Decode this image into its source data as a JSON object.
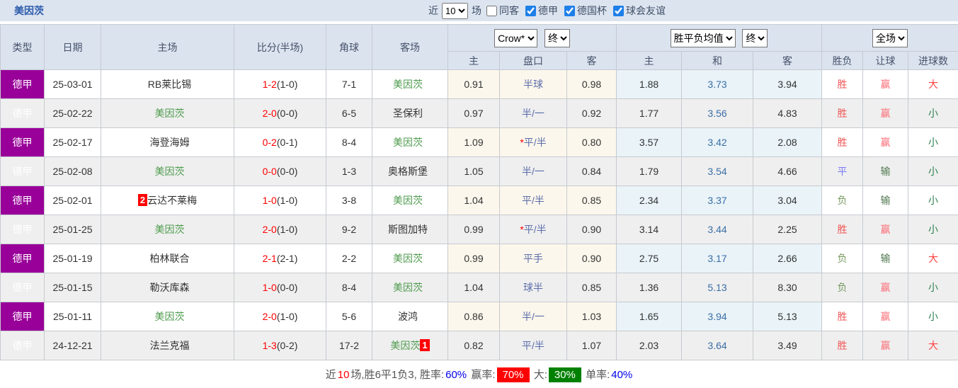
{
  "title": "美因茨",
  "topbar": {
    "near_label": "近",
    "recent_count": "10",
    "field_label": "场",
    "checkboxes": [
      {
        "label": "同客",
        "checked": false
      },
      {
        "label": "德甲",
        "checked": true
      },
      {
        "label": "德国杯",
        "checked": true
      },
      {
        "label": "球会友谊",
        "checked": true
      }
    ]
  },
  "header": {
    "cols": [
      "类型",
      "日期",
      "主场",
      "比分(半场)",
      "角球",
      "客场"
    ],
    "group1_select": "Crow*",
    "group1_final": "终",
    "group2_select": "胜平负均值",
    "group2_final": "终",
    "group3_select": "全场",
    "sub": [
      "主",
      "盘口",
      "客",
      "主",
      "和",
      "客",
      "胜负",
      "让球",
      "进球数"
    ]
  },
  "rows": [
    {
      "league": "德甲",
      "date": "25-03-01",
      "home": "RB莱比锡",
      "home_self": false,
      "home_badge": "",
      "score": "1-2",
      "half": "(1-0)",
      "corners": "7-1",
      "away": "美因茨",
      "away_self": true,
      "away_badge": "",
      "crow_home": "0.91",
      "handicap": "半球",
      "handicap_star": false,
      "crow_away": "0.98",
      "avg_home": "1.88",
      "avg_draw": "3.73",
      "avg_away": "3.94",
      "result": "胜",
      "cover": "赢",
      "goals": "大"
    },
    {
      "league": "德甲",
      "date": "25-02-22",
      "home": "美因茨",
      "home_self": true,
      "home_badge": "",
      "score": "2-0",
      "half": "(0-0)",
      "corners": "6-5",
      "away": "圣保利",
      "away_self": false,
      "away_badge": "",
      "crow_home": "0.97",
      "handicap": "半/一",
      "handicap_star": false,
      "crow_away": "0.92",
      "avg_home": "1.77",
      "avg_draw": "3.56",
      "avg_away": "4.83",
      "result": "胜",
      "cover": "赢",
      "goals": "小"
    },
    {
      "league": "德甲",
      "date": "25-02-17",
      "home": "海登海姆",
      "home_self": false,
      "home_badge": "",
      "score": "0-2",
      "half": "(0-1)",
      "corners": "8-4",
      "away": "美因茨",
      "away_self": true,
      "away_badge": "",
      "crow_home": "1.09",
      "handicap": "平/半",
      "handicap_star": true,
      "crow_away": "0.80",
      "avg_home": "3.57",
      "avg_draw": "3.42",
      "avg_away": "2.08",
      "result": "胜",
      "cover": "赢",
      "goals": "小"
    },
    {
      "league": "德甲",
      "date": "25-02-08",
      "home": "美因茨",
      "home_self": true,
      "home_badge": "",
      "score": "0-0",
      "half": "(0-0)",
      "corners": "1-3",
      "away": "奥格斯堡",
      "away_self": false,
      "away_badge": "",
      "crow_home": "1.05",
      "handicap": "半/一",
      "handicap_star": false,
      "crow_away": "0.84",
      "avg_home": "1.79",
      "avg_draw": "3.54",
      "avg_away": "4.66",
      "result": "平",
      "cover": "输",
      "goals": "小"
    },
    {
      "league": "德甲",
      "date": "25-02-01",
      "home": "云达不莱梅",
      "home_self": false,
      "home_badge": "2",
      "score": "1-0",
      "half": "(1-0)",
      "corners": "3-8",
      "away": "美因茨",
      "away_self": true,
      "away_badge": "",
      "crow_home": "1.04",
      "handicap": "平/半",
      "handicap_star": false,
      "crow_away": "0.85",
      "avg_home": "2.34",
      "avg_draw": "3.37",
      "avg_away": "3.04",
      "result": "负",
      "cover": "输",
      "goals": "小"
    },
    {
      "league": "德甲",
      "date": "25-01-25",
      "home": "美因茨",
      "home_self": true,
      "home_badge": "",
      "score": "2-0",
      "half": "(1-0)",
      "corners": "9-2",
      "away": "斯图加特",
      "away_self": false,
      "away_badge": "",
      "crow_home": "0.99",
      "handicap": "平/半",
      "handicap_star": true,
      "crow_away": "0.90",
      "avg_home": "3.14",
      "avg_draw": "3.44",
      "avg_away": "2.25",
      "result": "胜",
      "cover": "赢",
      "goals": "小"
    },
    {
      "league": "德甲",
      "date": "25-01-19",
      "home": "柏林联合",
      "home_self": false,
      "home_badge": "",
      "score": "2-1",
      "half": "(2-1)",
      "corners": "2-2",
      "away": "美因茨",
      "away_self": true,
      "away_badge": "",
      "crow_home": "0.99",
      "handicap": "平手",
      "handicap_star": false,
      "crow_away": "0.90",
      "avg_home": "2.75",
      "avg_draw": "3.17",
      "avg_away": "2.66",
      "result": "负",
      "cover": "输",
      "goals": "大"
    },
    {
      "league": "德甲",
      "date": "25-01-15",
      "home": "勒沃库森",
      "home_self": false,
      "home_badge": "",
      "score": "1-0",
      "half": "(0-0)",
      "corners": "8-4",
      "away": "美因茨",
      "away_self": true,
      "away_badge": "",
      "crow_home": "1.04",
      "handicap": "球半",
      "handicap_star": false,
      "crow_away": "0.85",
      "avg_home": "1.36",
      "avg_draw": "5.13",
      "avg_away": "8.30",
      "result": "负",
      "cover": "赢",
      "goals": "小"
    },
    {
      "league": "德甲",
      "date": "25-01-11",
      "home": "美因茨",
      "home_self": true,
      "home_badge": "",
      "score": "2-0",
      "half": "(1-0)",
      "corners": "5-6",
      "away": "波鸿",
      "away_self": false,
      "away_badge": "",
      "crow_home": "0.86",
      "handicap": "半/一",
      "handicap_star": false,
      "crow_away": "1.03",
      "avg_home": "1.65",
      "avg_draw": "3.94",
      "avg_away": "5.13",
      "result": "胜",
      "cover": "赢",
      "goals": "小"
    },
    {
      "league": "德甲",
      "date": "24-12-21",
      "home": "法兰克福",
      "home_self": false,
      "home_badge": "",
      "score": "1-3",
      "half": "(0-2)",
      "corners": "17-2",
      "away": "美因茨",
      "away_self": true,
      "away_badge": "1",
      "crow_home": "0.82",
      "handicap": "平/半",
      "handicap_star": false,
      "crow_away": "1.07",
      "avg_home": "2.03",
      "avg_draw": "3.64",
      "avg_away": "3.49",
      "result": "胜",
      "cover": "赢",
      "goals": "大"
    }
  ],
  "summary_parts": [
    {
      "t": "近",
      "s": "plain"
    },
    {
      "t": "10",
      "s": "red"
    },
    {
      "t": "场,胜6平1负3, 胜率:",
      "s": "plain"
    },
    {
      "t": "60%",
      "s": "blue"
    },
    {
      "t": " 赢率:",
      "s": "plain"
    },
    {
      "t": "70%",
      "s": "red-bg"
    },
    {
      "t": " 大:",
      "s": "plain"
    },
    {
      "t": "30%",
      "s": "green-bg"
    },
    {
      "t": " 单率:",
      "s": "plain"
    },
    {
      "t": "40%",
      "s": "blue"
    }
  ],
  "colors": {
    "league_badge_bg": "#990099",
    "title_blue": "#2b5bab",
    "header_bg": "#dbe3ef",
    "self_team_green": "#4d9b4d",
    "score_red": "#ff0000",
    "handicap_blue": "#5b6dab",
    "avg_draw_blue": "#3a6ea5",
    "crow_section_bg": "#fcf7ec",
    "avg_section_bg": "#e9f3f8",
    "win_red": "#f25555",
    "draw_blue": "#7b7bf5",
    "lose_green": "#789a63",
    "over_red": "#ff4040",
    "under_green": "#2e8050",
    "rate_red_bg": "#ff0000",
    "rate_green_bg": "#008000"
  }
}
